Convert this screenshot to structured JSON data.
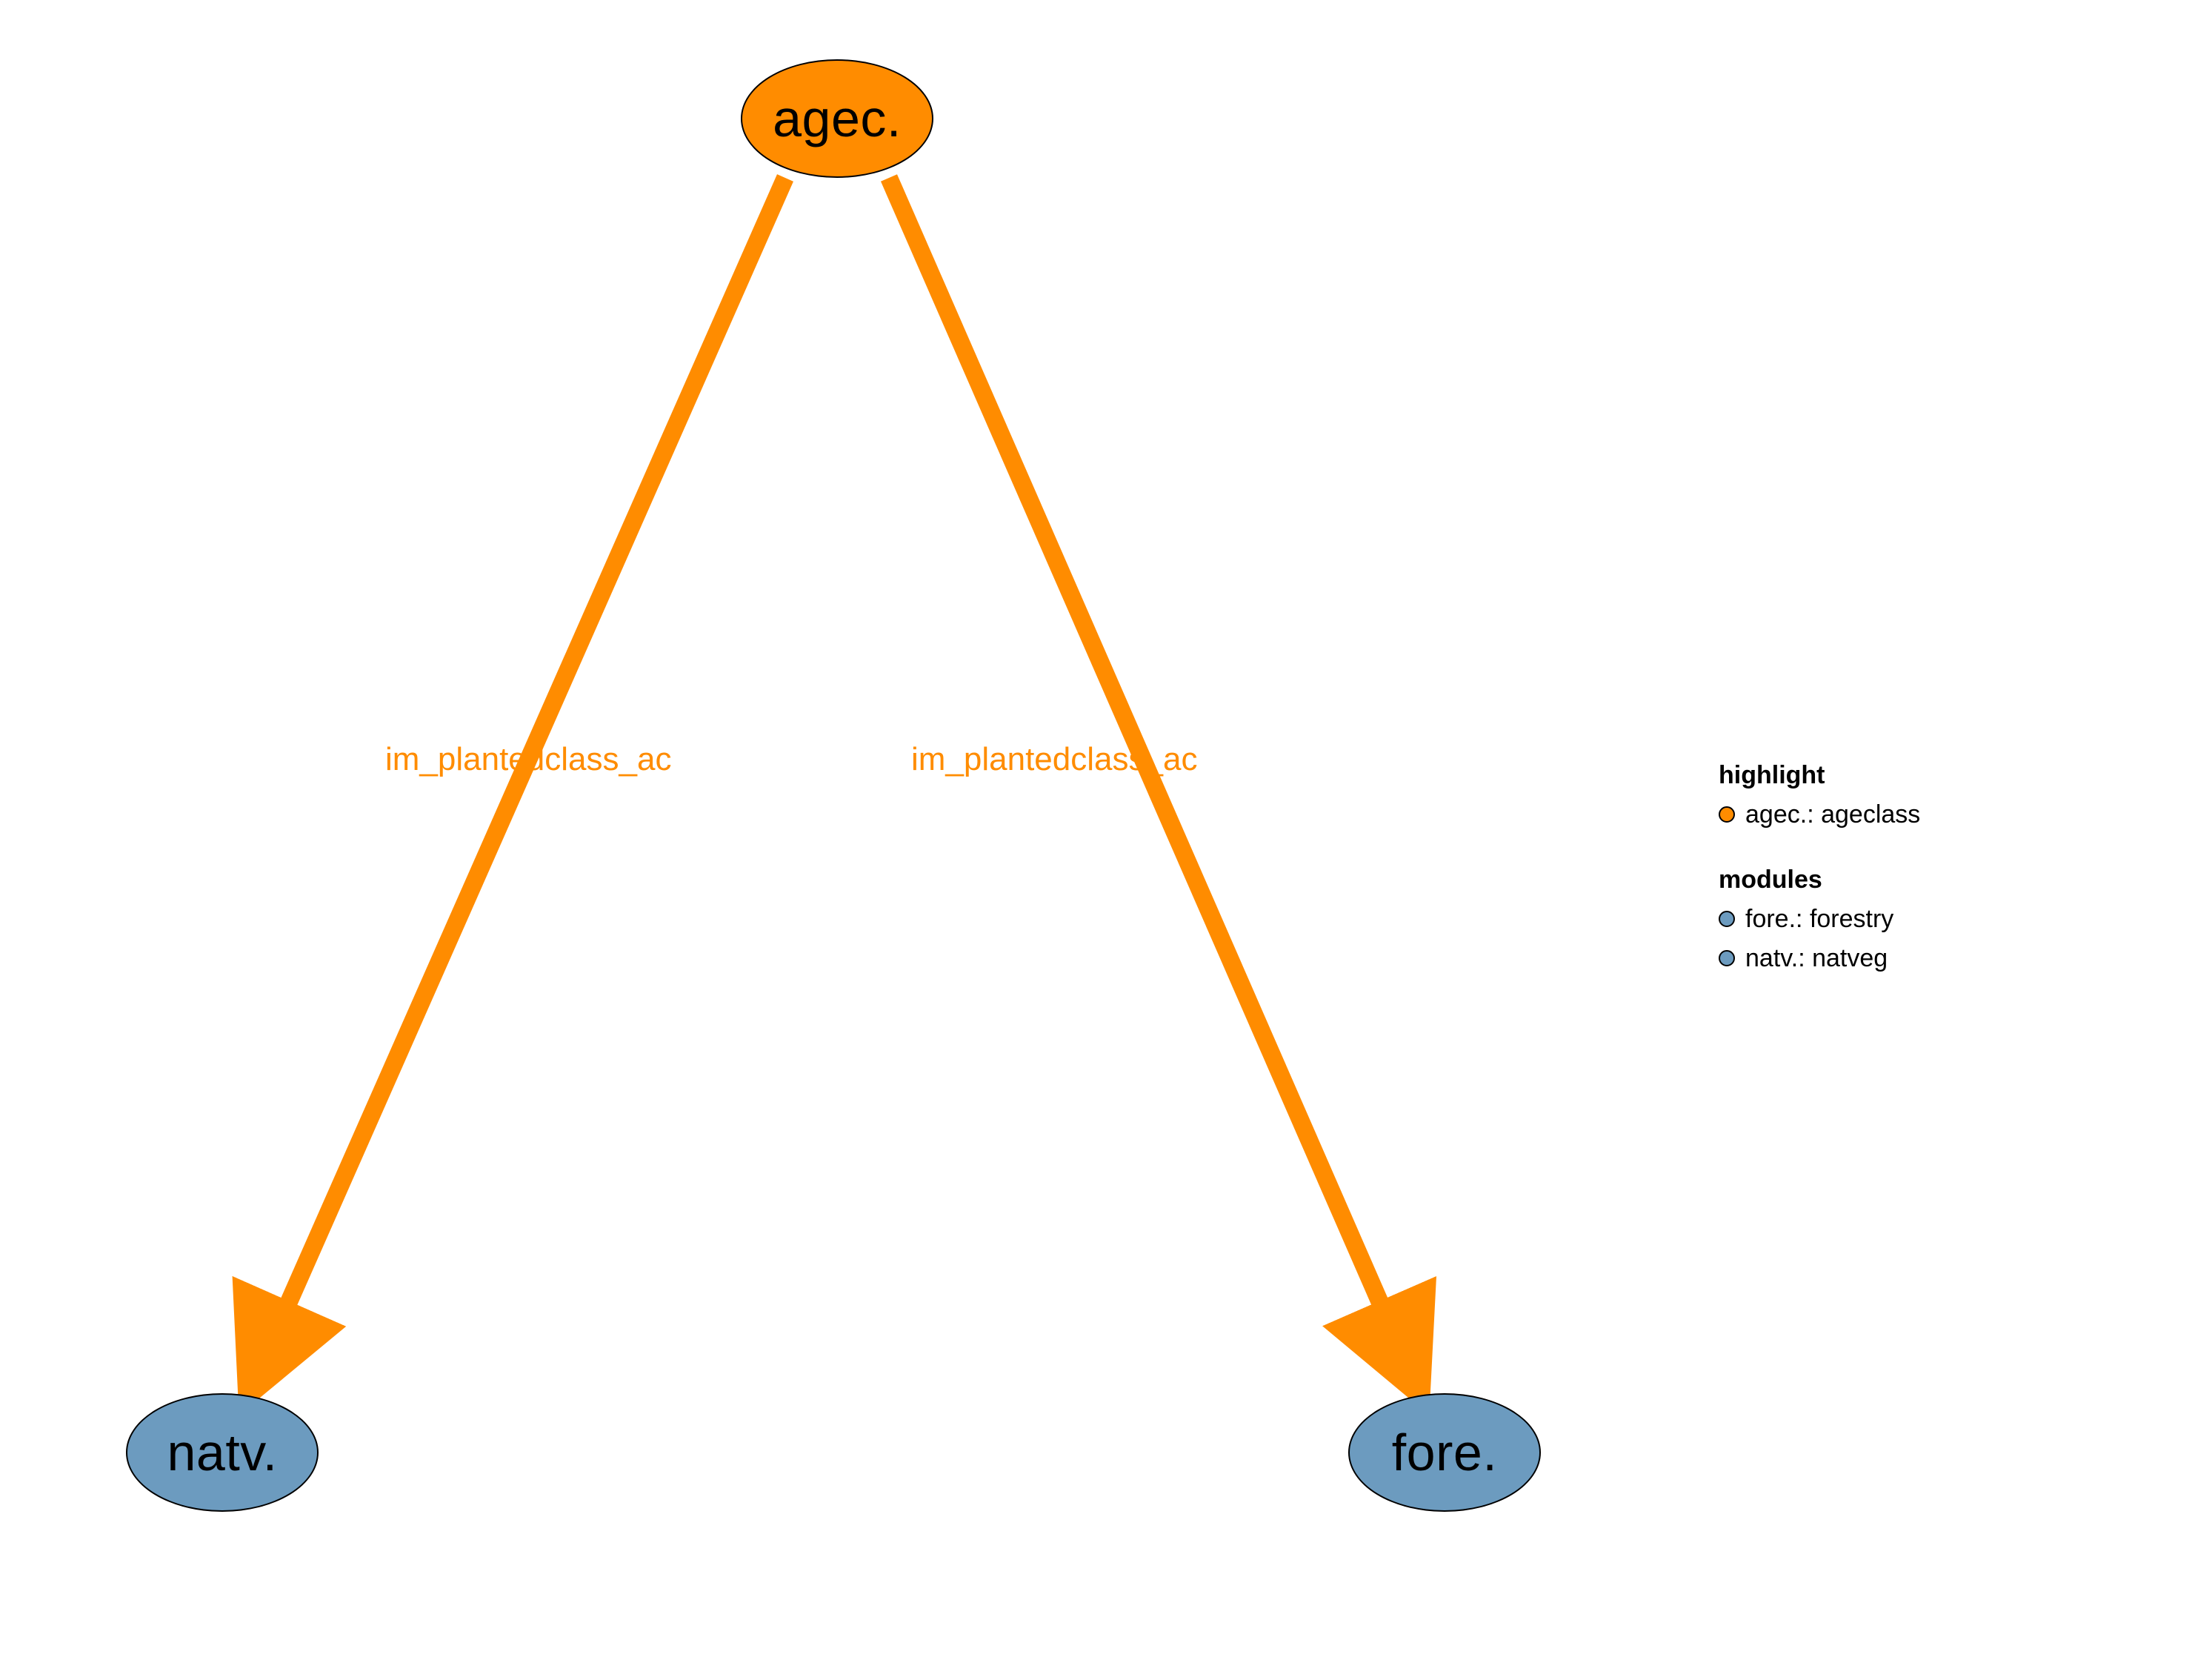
{
  "colors": {
    "highlight": "#ff8c00",
    "module": "#6c9bbf",
    "edge": "#ff8c00",
    "nodeStroke": "#000000"
  },
  "nodes": {
    "top": {
      "label": "agec.",
      "kind": "highlight"
    },
    "left": {
      "label": "natv.",
      "kind": "module"
    },
    "right": {
      "label": "fore.",
      "kind": "module"
    }
  },
  "edges": {
    "leftLabel": "im_plantedclass_ac",
    "rightLabel": "im_plantedclass_ac"
  },
  "legend": {
    "highlightTitle": "highlight",
    "modulesTitle": "modules",
    "entries": {
      "highlight": [
        {
          "abbr": "agec.",
          "full": "ageclass",
          "kind": "highlight"
        }
      ],
      "modules": [
        {
          "abbr": "fore.",
          "full": "forestry",
          "kind": "module"
        },
        {
          "abbr": "natv.",
          "full": "natveg",
          "kind": "module"
        }
      ]
    }
  }
}
